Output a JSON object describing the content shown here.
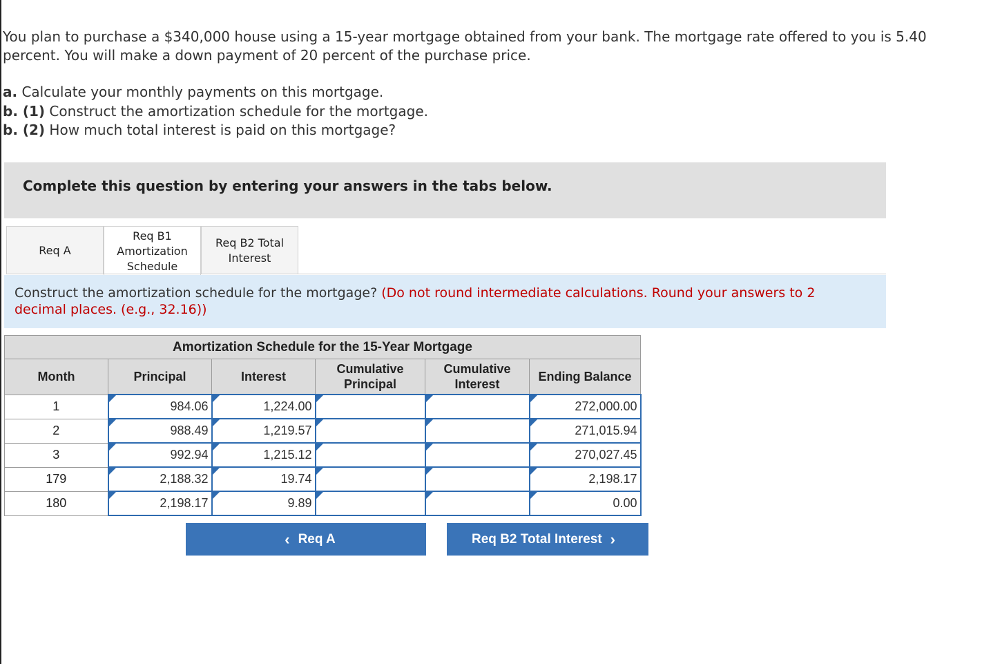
{
  "problem": {
    "line1": "You plan to purchase a $340,000 house using a 15-year mortgage obtained from your bank. The mortgage rate offered to you is 5.40",
    "line2": "percent. You will make a down payment of 20 percent of the purchase price.",
    "parts": [
      {
        "label": "a.",
        "text": " Calculate your monthly payments on this mortgage."
      },
      {
        "label": "b. (1)",
        "text": " Construct the amortization schedule for the mortgage."
      },
      {
        "label": "b. (2)",
        "text": " How much total interest is paid on this mortgage?"
      }
    ]
  },
  "banner": {
    "text": "Complete this question by entering your answers in the tabs below."
  },
  "tabs": [
    {
      "label": "Req A"
    },
    {
      "label": "Req B1 Amortization Schedule",
      "l1": "Req B1",
      "l2": "Amortization",
      "l3": "Schedule"
    },
    {
      "label": "Req B2 Total Interest",
      "l1": "Req B2 Total",
      "l2": "Interest"
    }
  ],
  "active_tab": "Req B1 Amortization Schedule",
  "instruction": {
    "main": "Construct the amortization schedule for the mortgage?",
    "note": "(Do not round intermediate calculations. Round your answers to 2 decimal places. (e.g., 32.16))"
  },
  "table": {
    "caption": "Amortization Schedule for the 15-Year Mortgage",
    "headers": {
      "month": "Month",
      "principal": "Principal",
      "interest": "Interest",
      "cum_principal_1": "Cumulative",
      "cum_principal_2": "Principal",
      "cum_interest_1": "Cumulative",
      "cum_interest_2": "Interest",
      "ending_balance": "Ending Balance"
    },
    "rows": [
      {
        "month": "1",
        "principal": "984.06",
        "interest": "1,224.00",
        "cum_principal": "",
        "cum_interest": "",
        "ending_balance": "272,000.00"
      },
      {
        "month": "2",
        "principal": "988.49",
        "interest": "1,219.57",
        "cum_principal": "",
        "cum_interest": "",
        "ending_balance": "271,015.94"
      },
      {
        "month": "3",
        "principal": "992.94",
        "interest": "1,215.12",
        "cum_principal": "",
        "cum_interest": "",
        "ending_balance": "270,027.45"
      },
      {
        "month": "179",
        "principal": "2,188.32",
        "interest": "19.74",
        "cum_principal": "",
        "cum_interest": "",
        "ending_balance": "2,198.17"
      },
      {
        "month": "180",
        "principal": "2,198.17",
        "interest": "9.89",
        "cum_principal": "",
        "cum_interest": "",
        "ending_balance": "0.00"
      }
    ]
  },
  "nav": {
    "prev_label": "Req A",
    "next_label": "Req B2 Total Interest",
    "prev_icon": "chevron-left-icon",
    "next_icon": "chevron-right-icon"
  },
  "colors": {
    "accent": "#3a74b8",
    "input_border": "#2e6bb0",
    "note_red": "#c00000",
    "instruction_bg": "#dcebf8",
    "banner_bg": "#e0e0e0"
  }
}
